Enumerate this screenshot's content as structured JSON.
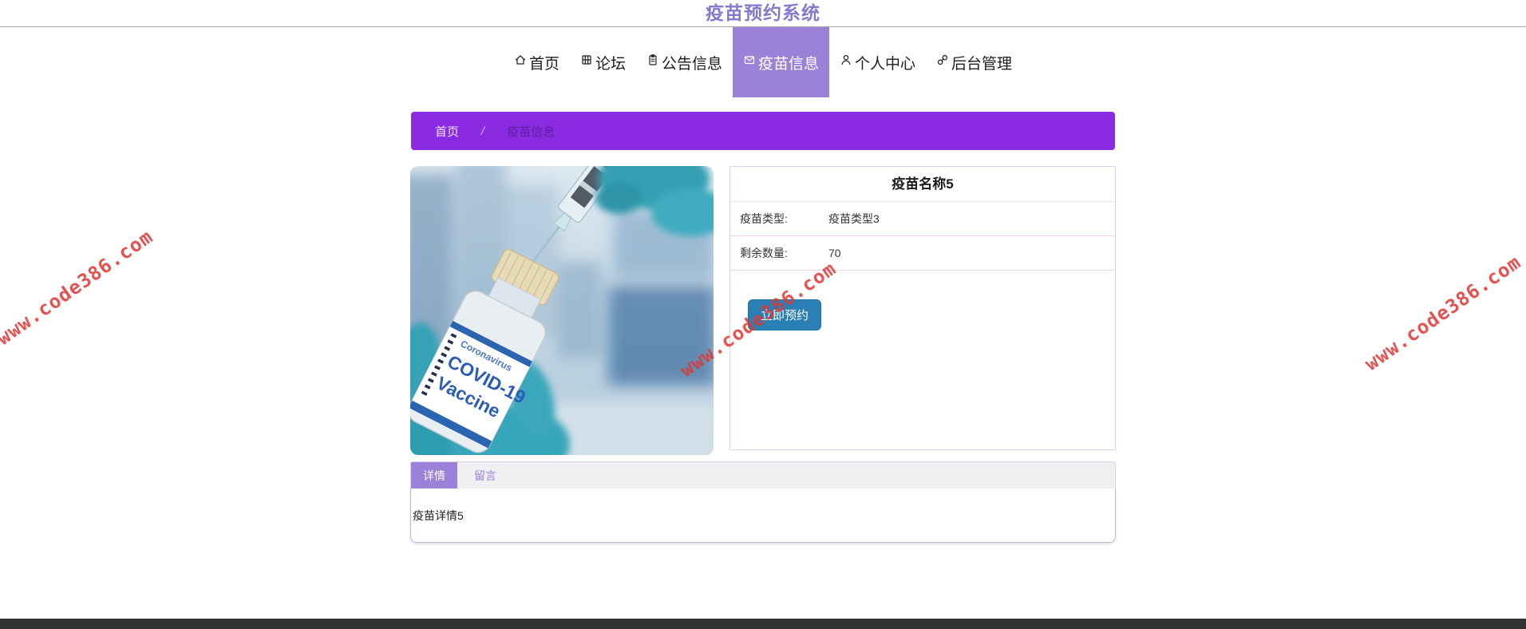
{
  "header": {
    "title": "疫苗预约系统"
  },
  "nav": {
    "items": [
      {
        "label": "首页",
        "icon": "home-icon",
        "active": false
      },
      {
        "label": "论坛",
        "icon": "forum-icon",
        "active": false
      },
      {
        "label": "公告信息",
        "icon": "bulletin-icon",
        "active": false
      },
      {
        "label": "疫苗信息",
        "icon": "envelope-icon",
        "active": true
      },
      {
        "label": "个人中心",
        "icon": "user-icon",
        "active": false
      },
      {
        "label": "后台管理",
        "icon": "link-icon",
        "active": false
      }
    ]
  },
  "breadcrumb": {
    "home": "首页",
    "separator": "/",
    "current": "疫苗信息"
  },
  "vaccine": {
    "name": "疫苗名称5",
    "rows": [
      {
        "label": "疫苗类型:",
        "value": "疫苗类型3"
      },
      {
        "label": "剩余数量:",
        "value": "70"
      }
    ],
    "reserve_button": "立即预约",
    "detail": "疫苗详情5"
  },
  "photo_label": {
    "line1": "Coronavirus",
    "line2": "COVID-19",
    "line3": "Vaccine"
  },
  "tabs": [
    {
      "label": "详情",
      "active": true
    },
    {
      "label": "留言",
      "active": false
    }
  ],
  "watermark": {
    "text": "www.code386.com",
    "color": "#e03434"
  },
  "colors": {
    "accent_purple": "#9b82d8",
    "breadcrumb_purple": "#8a2be2",
    "title_purple": "#8579cf",
    "button_blue": "#2a7fb5",
    "footer_dark": "#313131"
  }
}
